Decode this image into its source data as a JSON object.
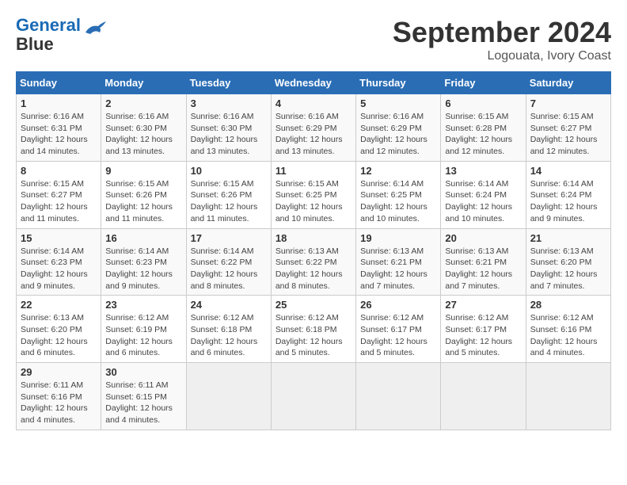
{
  "header": {
    "logo_line1": "General",
    "logo_line2": "Blue",
    "month": "September 2024",
    "location": "Logouata, Ivory Coast"
  },
  "days_of_week": [
    "Sunday",
    "Monday",
    "Tuesday",
    "Wednesday",
    "Thursday",
    "Friday",
    "Saturday"
  ],
  "weeks": [
    [
      {
        "day": "1",
        "sunrise": "6:16 AM",
        "sunset": "6:31 PM",
        "daylight": "12 hours and 14 minutes."
      },
      {
        "day": "2",
        "sunrise": "6:16 AM",
        "sunset": "6:30 PM",
        "daylight": "12 hours and 13 minutes."
      },
      {
        "day": "3",
        "sunrise": "6:16 AM",
        "sunset": "6:30 PM",
        "daylight": "12 hours and 13 minutes."
      },
      {
        "day": "4",
        "sunrise": "6:16 AM",
        "sunset": "6:29 PM",
        "daylight": "12 hours and 13 minutes."
      },
      {
        "day": "5",
        "sunrise": "6:16 AM",
        "sunset": "6:29 PM",
        "daylight": "12 hours and 12 minutes."
      },
      {
        "day": "6",
        "sunrise": "6:15 AM",
        "sunset": "6:28 PM",
        "daylight": "12 hours and 12 minutes."
      },
      {
        "day": "7",
        "sunrise": "6:15 AM",
        "sunset": "6:27 PM",
        "daylight": "12 hours and 12 minutes."
      }
    ],
    [
      {
        "day": "8",
        "sunrise": "6:15 AM",
        "sunset": "6:27 PM",
        "daylight": "12 hours and 11 minutes."
      },
      {
        "day": "9",
        "sunrise": "6:15 AM",
        "sunset": "6:26 PM",
        "daylight": "12 hours and 11 minutes."
      },
      {
        "day": "10",
        "sunrise": "6:15 AM",
        "sunset": "6:26 PM",
        "daylight": "12 hours and 11 minutes."
      },
      {
        "day": "11",
        "sunrise": "6:15 AM",
        "sunset": "6:25 PM",
        "daylight": "12 hours and 10 minutes."
      },
      {
        "day": "12",
        "sunrise": "6:14 AM",
        "sunset": "6:25 PM",
        "daylight": "12 hours and 10 minutes."
      },
      {
        "day": "13",
        "sunrise": "6:14 AM",
        "sunset": "6:24 PM",
        "daylight": "12 hours and 10 minutes."
      },
      {
        "day": "14",
        "sunrise": "6:14 AM",
        "sunset": "6:24 PM",
        "daylight": "12 hours and 9 minutes."
      }
    ],
    [
      {
        "day": "15",
        "sunrise": "6:14 AM",
        "sunset": "6:23 PM",
        "daylight": "12 hours and 9 minutes."
      },
      {
        "day": "16",
        "sunrise": "6:14 AM",
        "sunset": "6:23 PM",
        "daylight": "12 hours and 9 minutes."
      },
      {
        "day": "17",
        "sunrise": "6:14 AM",
        "sunset": "6:22 PM",
        "daylight": "12 hours and 8 minutes."
      },
      {
        "day": "18",
        "sunrise": "6:13 AM",
        "sunset": "6:22 PM",
        "daylight": "12 hours and 8 minutes."
      },
      {
        "day": "19",
        "sunrise": "6:13 AM",
        "sunset": "6:21 PM",
        "daylight": "12 hours and 7 minutes."
      },
      {
        "day": "20",
        "sunrise": "6:13 AM",
        "sunset": "6:21 PM",
        "daylight": "12 hours and 7 minutes."
      },
      {
        "day": "21",
        "sunrise": "6:13 AM",
        "sunset": "6:20 PM",
        "daylight": "12 hours and 7 minutes."
      }
    ],
    [
      {
        "day": "22",
        "sunrise": "6:13 AM",
        "sunset": "6:20 PM",
        "daylight": "12 hours and 6 minutes."
      },
      {
        "day": "23",
        "sunrise": "6:12 AM",
        "sunset": "6:19 PM",
        "daylight": "12 hours and 6 minutes."
      },
      {
        "day": "24",
        "sunrise": "6:12 AM",
        "sunset": "6:18 PM",
        "daylight": "12 hours and 6 minutes."
      },
      {
        "day": "25",
        "sunrise": "6:12 AM",
        "sunset": "6:18 PM",
        "daylight": "12 hours and 5 minutes."
      },
      {
        "day": "26",
        "sunrise": "6:12 AM",
        "sunset": "6:17 PM",
        "daylight": "12 hours and 5 minutes."
      },
      {
        "day": "27",
        "sunrise": "6:12 AM",
        "sunset": "6:17 PM",
        "daylight": "12 hours and 5 minutes."
      },
      {
        "day": "28",
        "sunrise": "6:12 AM",
        "sunset": "6:16 PM",
        "daylight": "12 hours and 4 minutes."
      }
    ],
    [
      {
        "day": "29",
        "sunrise": "6:11 AM",
        "sunset": "6:16 PM",
        "daylight": "12 hours and 4 minutes."
      },
      {
        "day": "30",
        "sunrise": "6:11 AM",
        "sunset": "6:15 PM",
        "daylight": "12 hours and 4 minutes."
      },
      null,
      null,
      null,
      null,
      null
    ]
  ]
}
